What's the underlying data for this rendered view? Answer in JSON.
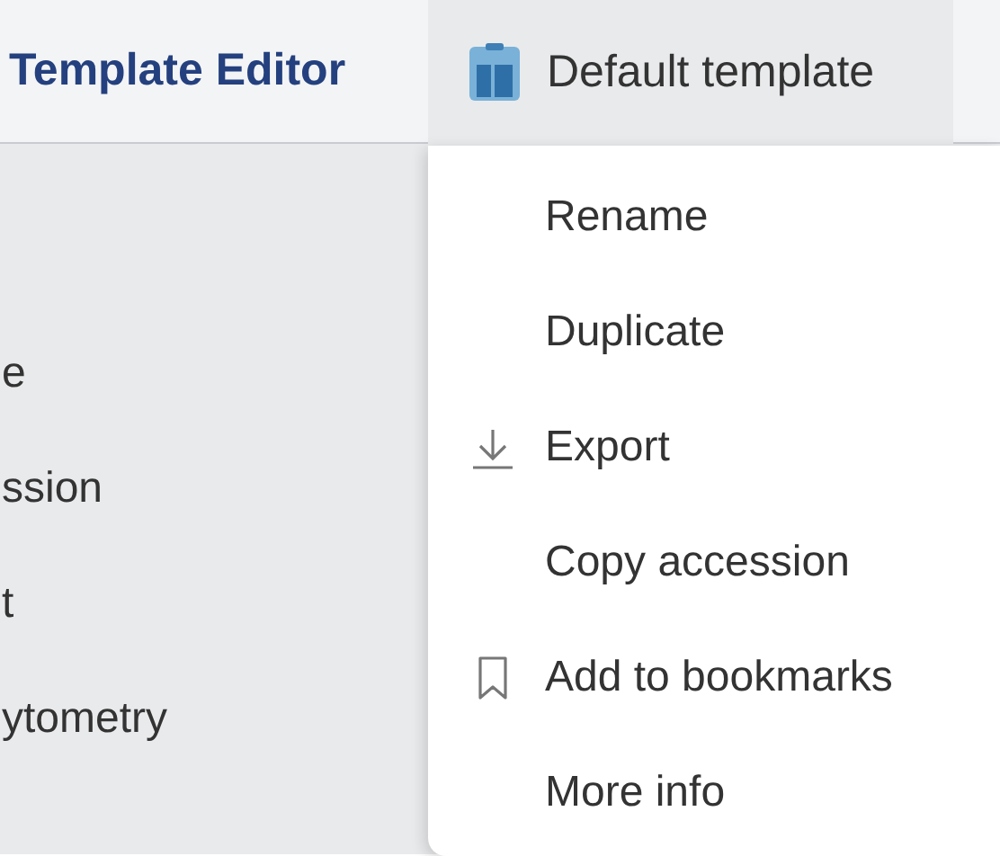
{
  "header": {
    "title": "Template Editor",
    "template_tab": {
      "label": "Default template"
    }
  },
  "sidebar": {
    "items": [
      {
        "label": "e"
      },
      {
        "label": "ssion"
      },
      {
        "label": "t"
      },
      {
        "label": "ytometry"
      }
    ]
  },
  "menu": {
    "items": [
      {
        "label": "Rename"
      },
      {
        "label": "Duplicate"
      },
      {
        "label": "Export"
      },
      {
        "label": "Copy accession"
      },
      {
        "label": "Add to bookmarks"
      },
      {
        "label": "More info"
      }
    ]
  }
}
